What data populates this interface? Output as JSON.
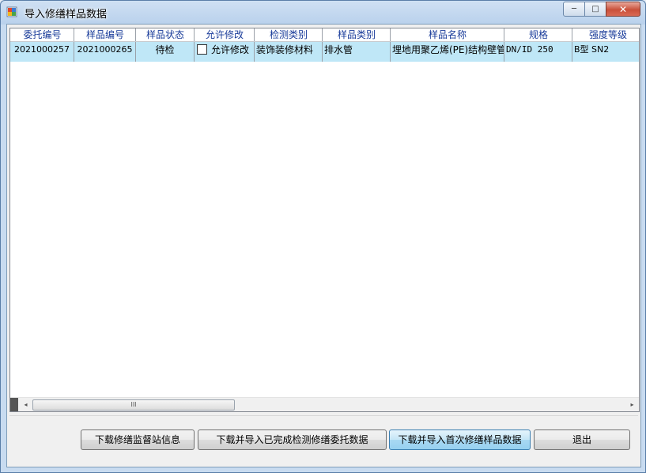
{
  "window": {
    "title": "导入修缮样品数据"
  },
  "title_buttons": {
    "minimize": "─",
    "maximize": "□",
    "close": "✕"
  },
  "grid": {
    "columns": [
      "委托编号",
      "样品编号",
      "样品状态",
      "允许修改",
      "检测类别",
      "样品类别",
      "样品名称",
      "规格",
      "强度等级"
    ],
    "rows": [
      [
        "2021000257",
        "2021000265",
        "待检",
        "允许修改",
        "装饰装修材料",
        "排水管",
        "埋地用聚乙烯(PE)结构壁管",
        "DN/ID 250",
        "B型 SN2"
      ]
    ],
    "scroll_thumb_glyph": "III",
    "scroll_left": "◂",
    "scroll_right": "▸"
  },
  "buttons": {
    "download_supervision": "下载修缮监督站信息",
    "download_import_completed": "下载并导入已完成检测修缮委托数据",
    "download_import_first": "下载并导入首次修缮样品数据",
    "exit": "退出"
  }
}
